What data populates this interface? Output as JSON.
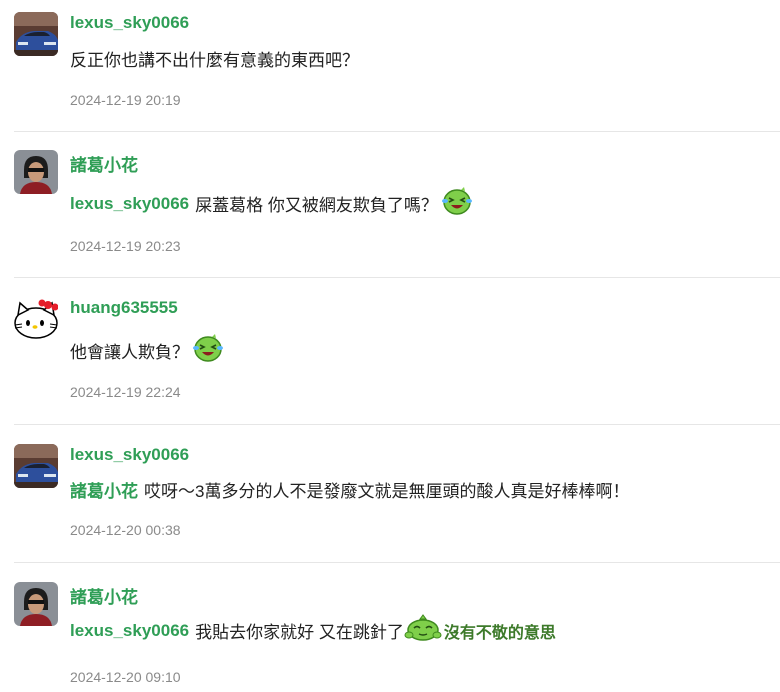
{
  "comments": [
    {
      "author": "lexus_sky0066",
      "avatar": "car-avatar",
      "mention": "",
      "text": "反正你也講不出什麼有意義的東西吧？",
      "timestamp": "2024-12-19 20:19"
    },
    {
      "author": "諸葛小花",
      "avatar": "person-avatar",
      "mention": "lexus_sky0066",
      "text": "屎蓋葛格 你又被網友欺負了嗎？",
      "emoji": "laughing-crying-emoji",
      "timestamp": "2024-12-19 20:23"
    },
    {
      "author": "huang635555",
      "avatar": "hello-kitty-avatar",
      "mention": "",
      "text": "他會讓人欺負？",
      "emoji": "laughing-crying-emoji",
      "timestamp": "2024-12-19 22:24"
    },
    {
      "author": "lexus_sky0066",
      "avatar": "car-avatar",
      "mention": "諸葛小花",
      "text": "哎呀～3萬多分的人不是發廢文就是無厘頭的酸人真是好棒棒啊！",
      "timestamp": "2024-12-20 00:38"
    },
    {
      "author": "諸葛小花",
      "avatar": "person-avatar",
      "mention": "lexus_sky0066",
      "text": "我貼去你家就好 又在跳針了",
      "sticker_text": "沒有不敬的意思",
      "emoji": "sticker-emoji",
      "timestamp": "2024-12-20 09:10"
    }
  ],
  "colors": {
    "username": "#2f9e56",
    "text": "#222222",
    "timestamp": "#8a8a8a",
    "divider": "#e6e6e6"
  }
}
